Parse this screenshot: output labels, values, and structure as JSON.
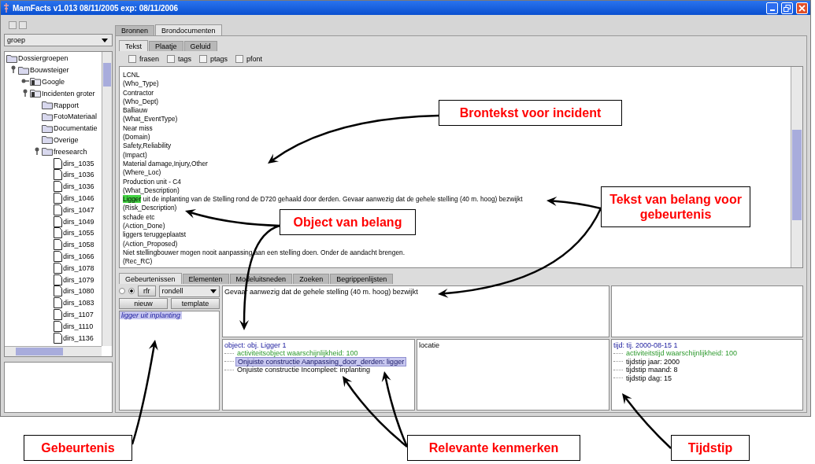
{
  "window": {
    "title": "MamFacts v1.013 08/11/2005 exp: 08/11/2006"
  },
  "sidebar": {
    "group_select": {
      "value": "groep"
    },
    "tree": [
      {
        "label": "Dossiergroepen",
        "kind": "folder",
        "children": [
          {
            "label": "Bouwsteiger",
            "kind": "folder",
            "expanded": true,
            "children": [
              {
                "label": "Google",
                "kind": "module",
                "expanded": false
              },
              {
                "label": "Incidenten groter",
                "kind": "module",
                "expanded": true,
                "children": [
                  {
                    "label": "Rapport",
                    "kind": "folder"
                  },
                  {
                    "label": "FotoMateriaal",
                    "kind": "folder"
                  },
                  {
                    "label": "Documentatie",
                    "kind": "folder"
                  },
                  {
                    "label": "Overige",
                    "kind": "folder"
                  },
                  {
                    "label": "freesearch",
                    "kind": "folder",
                    "expanded": true,
                    "children": [
                      {
                        "label": "dirs_1035",
                        "kind": "file"
                      },
                      {
                        "label": "dirs_1036",
                        "kind": "file"
                      },
                      {
                        "label": "dirs_1036",
                        "kind": "file"
                      },
                      {
                        "label": "dirs_1046",
                        "kind": "file"
                      },
                      {
                        "label": "dirs_1047",
                        "kind": "file"
                      },
                      {
                        "label": "dirs_1049",
                        "kind": "file"
                      },
                      {
                        "label": "dirs_1055",
                        "kind": "file"
                      },
                      {
                        "label": "dirs_1058",
                        "kind": "file"
                      },
                      {
                        "label": "dirs_1066",
                        "kind": "file"
                      },
                      {
                        "label": "dirs_1078",
                        "kind": "file"
                      },
                      {
                        "label": "dirs_1079",
                        "kind": "file"
                      },
                      {
                        "label": "dirs_1080",
                        "kind": "file"
                      },
                      {
                        "label": "dirs_1083",
                        "kind": "file"
                      },
                      {
                        "label": "dirs_1107",
                        "kind": "file"
                      },
                      {
                        "label": "dirs_1110",
                        "kind": "file"
                      },
                      {
                        "label": "dirs_1136",
                        "kind": "file"
                      }
                    ]
                  }
                ]
              }
            ]
          }
        ]
      }
    ]
  },
  "source_tabs": [
    {
      "label": "Bronnen",
      "selected": false
    },
    {
      "label": "Brondocumenten",
      "selected": true
    }
  ],
  "view_tabs": [
    {
      "label": "Tekst",
      "selected": true
    },
    {
      "label": "Plaatje",
      "selected": false
    },
    {
      "label": "Geluid",
      "selected": false
    }
  ],
  "options": [
    {
      "label": "frasen",
      "checked": false
    },
    {
      "label": "tags",
      "checked": false
    },
    {
      "label": "ptags",
      "checked": false
    },
    {
      "label": "pfont",
      "checked": false
    }
  ],
  "source_text": {
    "lines": [
      {
        "segments": [
          {
            "text": "LCNL",
            "highlighted": false
          }
        ]
      },
      {
        "segments": [
          {
            "text": "(Who_Type)",
            "highlighted": false
          }
        ]
      },
      {
        "segments": [
          {
            "text": "Contractor",
            "highlighted": false
          }
        ]
      },
      {
        "segments": [
          {
            "text": "(Who_Dept)",
            "highlighted": false
          }
        ]
      },
      {
        "segments": [
          {
            "text": "Balliauw",
            "highlighted": false
          }
        ]
      },
      {
        "segments": [
          {
            "text": "(What_EventType)",
            "highlighted": false
          }
        ]
      },
      {
        "segments": [
          {
            "text": "Near miss",
            "highlighted": false
          }
        ]
      },
      {
        "segments": [
          {
            "text": "(Domain)",
            "highlighted": false
          }
        ]
      },
      {
        "segments": [
          {
            "text": "Safety,Reliability",
            "highlighted": false
          }
        ]
      },
      {
        "segments": [
          {
            "text": "(Impact)",
            "highlighted": false
          }
        ]
      },
      {
        "segments": [
          {
            "text": "Material damage,Injury,Other",
            "highlighted": false
          }
        ]
      },
      {
        "segments": [
          {
            "text": "(Where_Loc)",
            "highlighted": false
          }
        ]
      },
      {
        "segments": [
          {
            "text": "Production unit - C4",
            "highlighted": false
          }
        ]
      },
      {
        "segments": [
          {
            "text": "(What_Description)",
            "highlighted": false
          }
        ]
      },
      {
        "segments": [
          {
            "text": "Ligger",
            "highlighted": true
          },
          {
            "text": " uit de inplanting van de Stelling rond de D720 gehaald door derden. Gevaar aanwezig dat de gehele stelling (40 m. hoog) bezwijkt",
            "highlighted": false
          }
        ]
      },
      {
        "segments": [
          {
            "text": "(Risk_Description)",
            "highlighted": false
          }
        ]
      },
      {
        "segments": [
          {
            "text": "schade etc",
            "highlighted": false
          }
        ]
      },
      {
        "segments": [
          {
            "text": "(Action_Done)",
            "highlighted": false
          }
        ]
      },
      {
        "segments": [
          {
            "text": "liggers teruggeplaatst",
            "highlighted": false
          }
        ]
      },
      {
        "segments": [
          {
            "text": "(Action_Proposed)",
            "highlighted": false
          }
        ]
      },
      {
        "segments": [
          {
            "text": "Niet stellingbouwer mogen nooit aanpassing aan een stelling doen. Onder de aandacht brengen.",
            "highlighted": false
          }
        ]
      },
      {
        "segments": [
          {
            "text": "(Rec_RC)",
            "highlighted": false
          }
        ]
      }
    ]
  },
  "bottom_tabs": [
    {
      "label": "Gebeurtenissen",
      "selected": true
    },
    {
      "label": "Elementen",
      "selected": false
    },
    {
      "label": "Modeluitsneden",
      "selected": false
    },
    {
      "label": "Zoeken",
      "selected": false
    },
    {
      "label": "Begrippenlijsten",
      "selected": false
    }
  ],
  "event_panel": {
    "radios": [
      {
        "selected": false
      },
      {
        "selected": true
      }
    ],
    "refresh_button": "rfr",
    "combo": {
      "value": "rondell"
    },
    "buttons": [
      "nieuw",
      "template"
    ],
    "events": [
      {
        "label": "ligger uit inplanting",
        "selected": true
      }
    ]
  },
  "event_text": "Gevaar aanwezig dat de gehele stelling (40 m. hoog) bezwijkt",
  "object_tree": {
    "label": "object: obj. Ligger 1",
    "children": [
      {
        "label": "activiteitsobject waarschijnlijkheid: 100",
        "kind": "probability",
        "selected": false
      },
      {
        "label": "Onjuiste constructie Aanpassing_door_derden: ligger",
        "kind": "attribute",
        "selected": true
      },
      {
        "label": "Onjuiste constructie Incompleet: inplanting",
        "kind": "attribute",
        "selected": false
      }
    ]
  },
  "location": {
    "label": "locatie"
  },
  "time_tree": {
    "label": "tijd: tij. 2000-08-15 1",
    "children": [
      {
        "label": "activiteitstijd waarschijnlijkheid: 100",
        "kind": "probability",
        "selected": false
      },
      {
        "label": "tijdstip jaar: 2000",
        "kind": "attribute",
        "selected": false
      },
      {
        "label": "tijdstip maand: 8",
        "kind": "attribute",
        "selected": false
      },
      {
        "label": "tijdstip dag: 15",
        "kind": "attribute",
        "selected": false
      }
    ]
  },
  "annotations": [
    {
      "text": "Brontekst voor incident"
    },
    {
      "text": "Tekst van belang voor gebeurtenis"
    },
    {
      "text": "Object van belang"
    },
    {
      "text": "Gebeurtenis"
    },
    {
      "text": "Relevante kenmerken"
    },
    {
      "text": "Tijdstip"
    }
  ]
}
